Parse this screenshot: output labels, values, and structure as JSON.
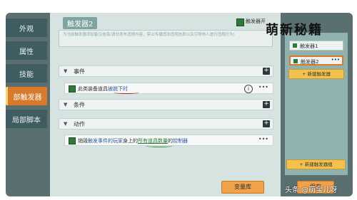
{
  "nav": {
    "items": [
      "外观",
      "属性",
      "技能",
      "部触发器",
      "局部脚本"
    ],
    "active_index": 3
  },
  "panel": {
    "title": "触发器2",
    "open_label": "触发器开",
    "notes": "为当前触发器添加备注信息(请勿发布违规内容，禁止传播违法违规信息以及引导他人进行违规行为)"
  },
  "sections": {
    "event": {
      "label": "事件",
      "row": {
        "part1": "此类装备道具",
        "part2": "被脱下时"
      }
    },
    "condition": {
      "label": "条件"
    },
    "action": {
      "label": "动作",
      "row": {
        "p1": "销毁",
        "p2": "触发事件的玩家",
        "p3": "身上的",
        "p4": "所有道具数量",
        "p5": "的",
        "p6": "控制器"
      }
    }
  },
  "sidebar": {
    "items": [
      "触发器1",
      "触发器2"
    ],
    "selected_index": 1,
    "add_trigger": "+ 新建触发器",
    "add_group": "+ 新建触发器组"
  },
  "footer": {
    "button1": "变量库",
    "button2": "保存"
  },
  "watermark": {
    "top": "萌新秘籍",
    "bottom": "头条 @萌宝儿呀"
  }
}
